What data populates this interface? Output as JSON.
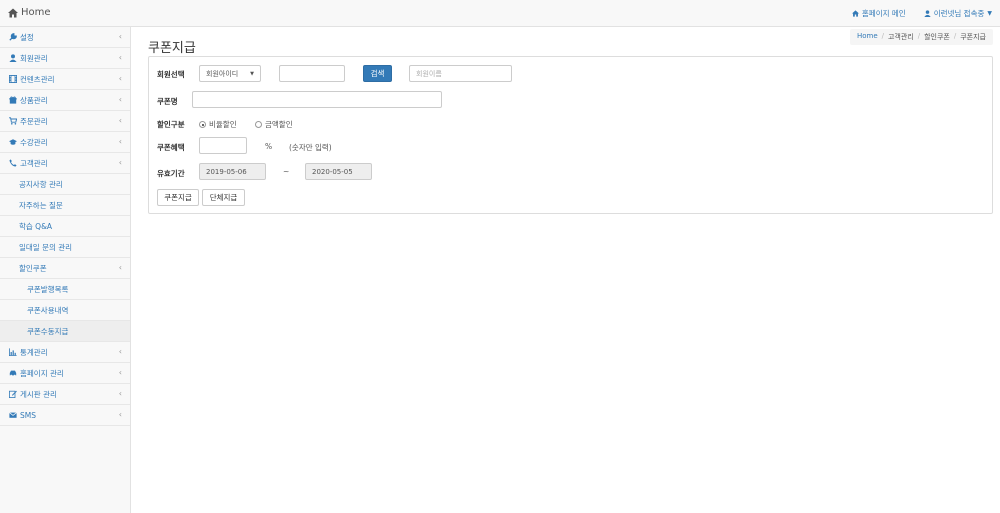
{
  "topbar": {
    "brand": "Home",
    "homepage_link": "홈페이지 메인",
    "user_menu": "이런넷님 접속중"
  },
  "sidebar": {
    "items": [
      {
        "label": "설정",
        "icon": "wrench-icon"
      },
      {
        "label": "회원관리",
        "icon": "user-icon"
      },
      {
        "label": "컨텐츠관리",
        "icon": "film-icon"
      },
      {
        "label": "상품관리",
        "icon": "gift-icon"
      },
      {
        "label": "주문관리",
        "icon": "cart-icon"
      },
      {
        "label": "수강관리",
        "icon": "graduation-cap-icon"
      },
      {
        "label": "고객관리",
        "icon": "phone-icon"
      },
      {
        "label": "공지사항 관리"
      },
      {
        "label": "자주하는 질문"
      },
      {
        "label": "학습 Q&A"
      },
      {
        "label": "일대일 문의 관리"
      },
      {
        "label": "할인쿠폰"
      },
      {
        "label": "쿠폰발행목록"
      },
      {
        "label": "쿠폰사용내역"
      },
      {
        "label": "쿠폰수동지급"
      },
      {
        "label": "통계관리",
        "icon": "bar-chart-icon"
      },
      {
        "label": "홈페이지 관리",
        "icon": "car-icon"
      },
      {
        "label": "게시판 관리",
        "icon": "edit-icon"
      },
      {
        "label": "SMS",
        "icon": "envelope-icon"
      }
    ]
  },
  "page": {
    "title": "쿠폰지급",
    "breadcrumb": [
      "Home",
      "고객관리",
      "할인쿠폰",
      "쿠폰지급"
    ]
  },
  "form": {
    "member_select_label": "회원선택",
    "member_select_value": "회원아이디",
    "member_search_value": "",
    "search_button": "검색",
    "member_name_placeholder": "회원이름",
    "coupon_name_label": "쿠폰명",
    "coupon_name_value": "",
    "discount_type_label": "할인구분",
    "discount_rate_option": "비율할인",
    "discount_amount_option": "금액할인",
    "discount_selected": "rate",
    "benefit_label": "쿠폰혜택",
    "benefit_value": "",
    "benefit_unit": "%",
    "benefit_hint": "(숫자만 입력)",
    "validity_label": "유효기간",
    "validity_start": "2019-05-06",
    "validity_sep": "~",
    "validity_end": "2020-05-05",
    "issue_button": "쿠폰지급",
    "bulk_issue_button": "단체지급"
  }
}
